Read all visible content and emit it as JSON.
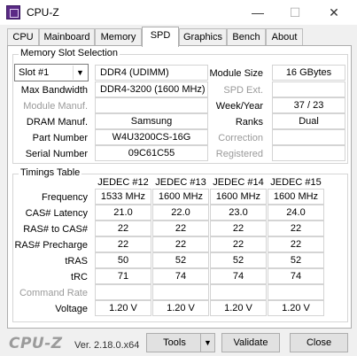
{
  "window": {
    "title": "CPU-Z",
    "minimize": "—",
    "maximize": "☐",
    "close": "✕"
  },
  "tabs": [
    {
      "label": "CPU"
    },
    {
      "label": "Mainboard"
    },
    {
      "label": "Memory"
    },
    {
      "label": "SPD"
    },
    {
      "label": "Graphics"
    },
    {
      "label": "Bench"
    },
    {
      "label": "About"
    }
  ],
  "slot_selection": {
    "title": "Memory Slot Selection",
    "slot": "Slot #1",
    "module_type": "DDR4 (UDIMM)",
    "labels": {
      "module_size": "Module Size",
      "max_bandwidth": "Max Bandwidth",
      "spd_ext": "SPD Ext.",
      "module_manuf": "Module Manuf.",
      "week_year": "Week/Year",
      "dram_manuf": "DRAM Manuf.",
      "ranks": "Ranks",
      "part_number": "Part Number",
      "correction": "Correction",
      "serial_number": "Serial Number",
      "registered": "Registered"
    },
    "values": {
      "module_size": "16 GBytes",
      "max_bandwidth": "DDR4-3200 (1600 MHz)",
      "spd_ext": "",
      "module_manuf": "",
      "week_year": "37 / 23",
      "dram_manuf": "Samsung",
      "ranks": "Dual",
      "part_number": "W4U3200CS-16G",
      "correction": "",
      "serial_number": "09C61C55",
      "registered": ""
    }
  },
  "timings": {
    "title": "Timings Table",
    "columns": [
      "JEDEC #12",
      "JEDEC #13",
      "JEDEC #14",
      "JEDEC #15"
    ],
    "rows": [
      {
        "label": "Frequency",
        "values": [
          "1533 MHz",
          "1600 MHz",
          "1600 MHz",
          "1600 MHz"
        ]
      },
      {
        "label": "CAS# Latency",
        "values": [
          "21.0",
          "22.0",
          "23.0",
          "24.0"
        ]
      },
      {
        "label": "RAS# to CAS#",
        "values": [
          "22",
          "22",
          "22",
          "22"
        ]
      },
      {
        "label": "RAS# Precharge",
        "values": [
          "22",
          "22",
          "22",
          "22"
        ]
      },
      {
        "label": "tRAS",
        "values": [
          "50",
          "52",
          "52",
          "52"
        ]
      },
      {
        "label": "tRC",
        "values": [
          "71",
          "74",
          "74",
          "74"
        ]
      },
      {
        "label": "Command Rate",
        "values": [
          "",
          "",
          "",
          ""
        ]
      },
      {
        "label": "Voltage",
        "values": [
          "1.20 V",
          "1.20 V",
          "1.20 V",
          "1.20 V"
        ]
      }
    ]
  },
  "footer": {
    "brand": "CPU-Z",
    "version": "Ver. 2.18.0.x64",
    "tools": "Tools",
    "tools_arrow": "▼",
    "validate": "Validate",
    "close": "Close"
  }
}
